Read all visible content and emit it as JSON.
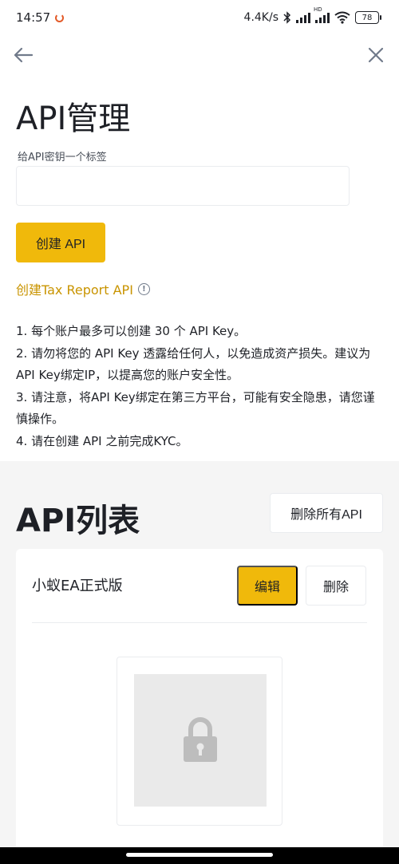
{
  "status_bar": {
    "time": "14:57",
    "network_speed": "4.4K/s",
    "signal_label": "HD",
    "battery": "78",
    "icons": [
      "notification-ring-icon",
      "bluetooth-icon",
      "signal-icon",
      "hd-signal-icon",
      "wifi-icon",
      "battery-icon"
    ]
  },
  "nav": {
    "back_icon": "arrow-left-icon",
    "close_icon": "close-icon"
  },
  "create_section": {
    "title": "API管理",
    "label_field_label": "给API密钥一个标签",
    "label_field_value": "",
    "label_field_placeholder": "",
    "create_button": "创建 API",
    "tax_report_link": "创建Tax Report API",
    "notes": [
      "1. 每个账户最多可以创建 30 个 API Key。",
      "2. 请勿将您的 API Key 透露给任何人，以免造成资产损失。建议为API Key绑定IP，以提高您的账户安全性。",
      "3. 请注意，将API Key绑定在第三方平台，可能有安全隐患，请您谨慎操作。",
      "4. 请在创建 API 之前完成KYC。"
    ]
  },
  "list_section": {
    "title": "API列表",
    "delete_all_button": "删除所有API",
    "items": [
      {
        "name": "小蚁EA正式版",
        "edit_button": "编辑",
        "delete_button": "删除",
        "qr_placeholder_icon": "lock-icon"
      }
    ]
  },
  "colors": {
    "accent": "#f0b90b",
    "link": "#c99400",
    "text": "#1e2026",
    "muted": "#707a8a",
    "section_bg": "#f5f5f5"
  }
}
